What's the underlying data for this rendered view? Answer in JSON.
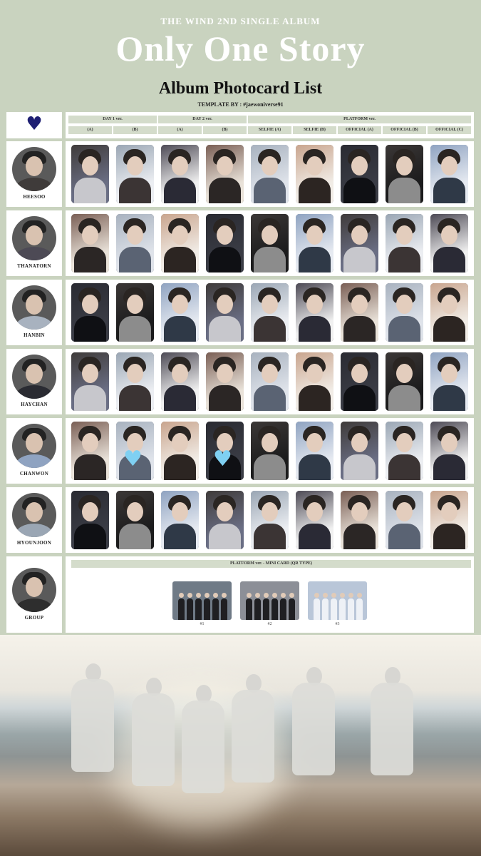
{
  "header": {
    "kicker": "THE WIND 2ND SINGLE ALBUM",
    "title": "Only One Story",
    "subtitle": "Album Photocard List",
    "template_credit": "TEMPLATE BY : #jaewoniverse91"
  },
  "columns": {
    "groups": [
      {
        "label": "DAY 1 ver."
      },
      {
        "label": "DAY 2 ver."
      },
      {
        "label": "PLATFORM ver."
      }
    ],
    "sub": [
      "(A)",
      "(B)",
      "(A)",
      "(B)",
      "SELFIE (A)",
      "SELFIE (B)",
      "OFFICIAL (A)",
      "OFFICIAL (B)",
      "OFFICIAL (C)"
    ]
  },
  "members": [
    {
      "name": "HEESOO"
    },
    {
      "name": "THANATORN"
    },
    {
      "name": "HANBIN"
    },
    {
      "name": "HAYCHAN"
    },
    {
      "name": "CHANWON",
      "hearts": [
        1,
        3
      ]
    },
    {
      "name": "HYOUNJOON"
    }
  ],
  "group_row": {
    "name": "GROUP",
    "heading": "PLATFORM ver. - MINI CARD (QR TYPE)",
    "cards": [
      {
        "label": "#1"
      },
      {
        "label": "#2"
      },
      {
        "label": "#3"
      }
    ]
  },
  "colors": {
    "background": "#c9d3bf",
    "header_fill": "#d4dccb",
    "heart": "#7fd0f2",
    "logo": "#1e1f73"
  },
  "icons": {
    "logo": "heart-logo-icon",
    "sticker": "blue-heart-icon"
  }
}
